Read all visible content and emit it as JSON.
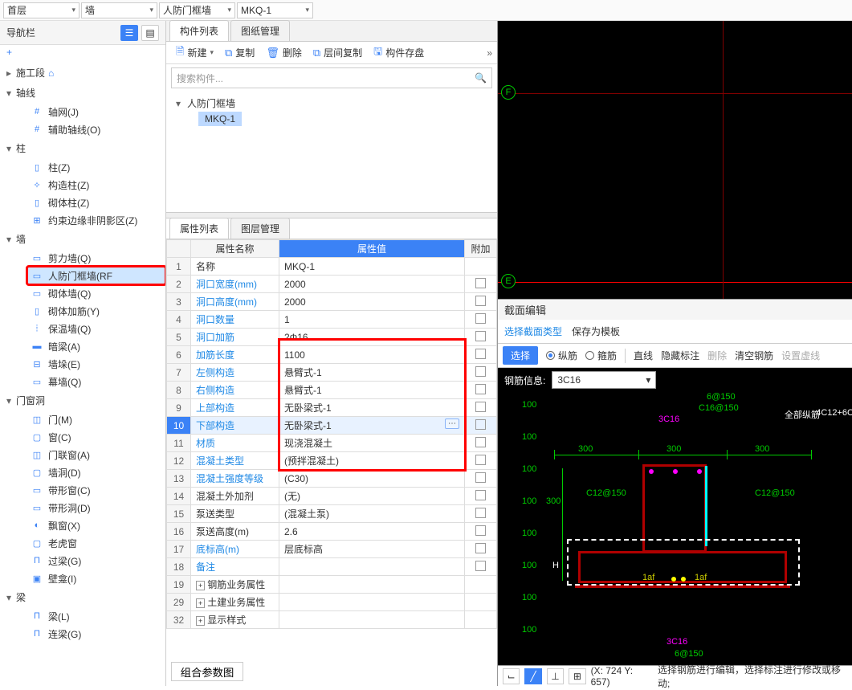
{
  "top": {
    "dd1": "首层",
    "dd2": "墙",
    "dd3": "人防门框墙",
    "dd4": "MKQ-1"
  },
  "nav": {
    "title": "导航栏",
    "add": "+",
    "groups": [
      {
        "open": false,
        "label": "施工段",
        "icon": "⌂",
        "items": []
      },
      {
        "open": true,
        "label": "轴线",
        "items": [
          {
            "ico": "#",
            "label": "轴网(J)"
          },
          {
            "ico": "#",
            "label": "辅助轴线(O)"
          }
        ]
      },
      {
        "open": true,
        "label": "柱",
        "items": [
          {
            "ico": "▯",
            "label": "柱(Z)"
          },
          {
            "ico": "✧",
            "label": "构造柱(Z)"
          },
          {
            "ico": "▯",
            "label": "砌体柱(Z)"
          },
          {
            "ico": "⊞",
            "label": "约束边缘非阴影区(Z)"
          }
        ]
      },
      {
        "open": true,
        "label": "墙",
        "items": [
          {
            "ico": "▭",
            "label": "剪力墙(Q)"
          },
          {
            "ico": "▭",
            "label": "人防门框墙(RF",
            "sel": true,
            "red": true
          },
          {
            "ico": "▭",
            "label": "砌体墙(Q)"
          },
          {
            "ico": "▯",
            "label": "砌体加筋(Y)"
          },
          {
            "ico": "⦙",
            "label": "保温墙(Q)"
          },
          {
            "ico": "▬",
            "label": "暗梁(A)"
          },
          {
            "ico": "⊟",
            "label": "墙垛(E)"
          },
          {
            "ico": "▭",
            "label": "幕墙(Q)"
          }
        ]
      },
      {
        "open": true,
        "label": "门窗洞",
        "items": [
          {
            "ico": "◫",
            "label": "门(M)"
          },
          {
            "ico": "▢",
            "label": "窗(C)"
          },
          {
            "ico": "◫",
            "label": "门联窗(A)"
          },
          {
            "ico": "▢",
            "label": "墙洞(D)"
          },
          {
            "ico": "▭",
            "label": "带形窗(C)"
          },
          {
            "ico": "▭",
            "label": "带形洞(D)"
          },
          {
            "ico": "◐",
            "label": "飘窗(X)"
          },
          {
            "ico": "▢",
            "label": "老虎窗"
          },
          {
            "ico": "Π",
            "label": "过梁(G)"
          },
          {
            "ico": "▣",
            "label": "壁龛(I)"
          }
        ]
      },
      {
        "open": true,
        "label": "梁",
        "items": [
          {
            "ico": "Π",
            "label": "梁(L)"
          },
          {
            "ico": "Π",
            "label": "连梁(G)"
          }
        ]
      }
    ]
  },
  "mid": {
    "tabs": [
      "构件列表",
      "图纸管理"
    ],
    "toolbar": [
      {
        "ico": "🗎",
        "label": "新建",
        "dd": true
      },
      {
        "ico": "⧉",
        "label": "复制"
      },
      {
        "ico": "🗑",
        "label": "删除"
      },
      {
        "ico": "⧉",
        "label": "层间复制"
      },
      {
        "ico": "🖫",
        "label": "构件存盘"
      }
    ],
    "search_ph": "搜索构件...",
    "tree_root": "人防门框墙",
    "tree_child": "MKQ-1",
    "prop_tabs": [
      "属性列表",
      "图层管理"
    ],
    "headers": {
      "name": "属性名称",
      "value": "属性值",
      "add": "附加"
    },
    "rows": [
      {
        "i": "1",
        "n": "名称",
        "v": "MKQ-1",
        "c": false
      },
      {
        "i": "2",
        "n": "洞口宽度(mm)",
        "v": "2000",
        "link": true,
        "c": true
      },
      {
        "i": "3",
        "n": "洞口高度(mm)",
        "v": "2000",
        "link": true,
        "c": true
      },
      {
        "i": "4",
        "n": "洞口数量",
        "v": "1",
        "link": true,
        "c": true
      },
      {
        "i": "5",
        "n": "洞口加筋",
        "v": "2Φ16",
        "link": true,
        "c": true
      },
      {
        "i": "6",
        "n": "加筋长度",
        "v": "1100",
        "link": true,
        "c": true
      },
      {
        "i": "7",
        "n": "左侧构造",
        "v": "悬臂式-1",
        "link": true,
        "c": true
      },
      {
        "i": "8",
        "n": "右侧构造",
        "v": "悬臂式-1",
        "link": true,
        "c": true
      },
      {
        "i": "9",
        "n": "上部构造",
        "v": "无卧梁式-1",
        "link": true,
        "c": true
      },
      {
        "i": "10",
        "n": "下部构造",
        "v": "无卧梁式-1",
        "link": true,
        "c": true,
        "sel": true,
        "ellip": true
      },
      {
        "i": "11",
        "n": "材质",
        "v": "现浇混凝土",
        "link": true,
        "c": true
      },
      {
        "i": "12",
        "n": "混凝土类型",
        "v": "(预拌混凝土)",
        "link": true,
        "c": true
      },
      {
        "i": "13",
        "n": "混凝土强度等级",
        "v": "(C30)",
        "link": true,
        "c": true
      },
      {
        "i": "14",
        "n": "混凝土外加剂",
        "v": "(无)",
        "c": true
      },
      {
        "i": "15",
        "n": "泵送类型",
        "v": "(混凝土泵)",
        "c": true
      },
      {
        "i": "16",
        "n": "泵送高度(m)",
        "v": "2.6",
        "c": true
      },
      {
        "i": "17",
        "n": "底标高(m)",
        "v": "层底标高",
        "link": true,
        "c": true
      },
      {
        "i": "18",
        "n": "备注",
        "v": "",
        "link": true,
        "c": true
      },
      {
        "i": "19",
        "n": "钢筋业务属性",
        "v": "",
        "exp": true
      },
      {
        "i": "29",
        "n": "土建业务属性",
        "v": "",
        "exp": true
      },
      {
        "i": "32",
        "n": "显示样式",
        "v": "",
        "exp": true
      }
    ],
    "combo_btn": "组合参数图"
  },
  "right": {
    "labels": {
      "F": "F",
      "E": "E"
    },
    "sect_title": "截面编辑",
    "type_label": "选择截面类型",
    "save_tpl": "保存为模板",
    "tb": {
      "select": "选择",
      "long": "纵筋",
      "hoop": "箍筋",
      "line": "直线",
      "hide": "隐藏标注",
      "del": "删除",
      "clear": "清空钢筋",
      "dash": "设置虚线"
    },
    "rebar_label": "钢筋信息:",
    "rebar_value": "3C16",
    "dims": {
      "d300a": "300",
      "d300b": "300",
      "d300c": "300",
      "d300v": "300",
      "t100": "100"
    },
    "annot": {
      "t1": "6@150",
      "t2": "C16@150",
      "t3": "3C16",
      "t4": "C12@150",
      "t5": "C12@150",
      "t6": "3C16",
      "t7": "6@150",
      "all": "全部纵筋",
      "extra": "4C12+6C",
      "laf": "1af",
      "H": "H"
    },
    "status": {
      "coords": "(X: 724 Y: 657)",
      "hint": "选择钢筋进行编辑，选择标注进行修改或移动;"
    }
  }
}
